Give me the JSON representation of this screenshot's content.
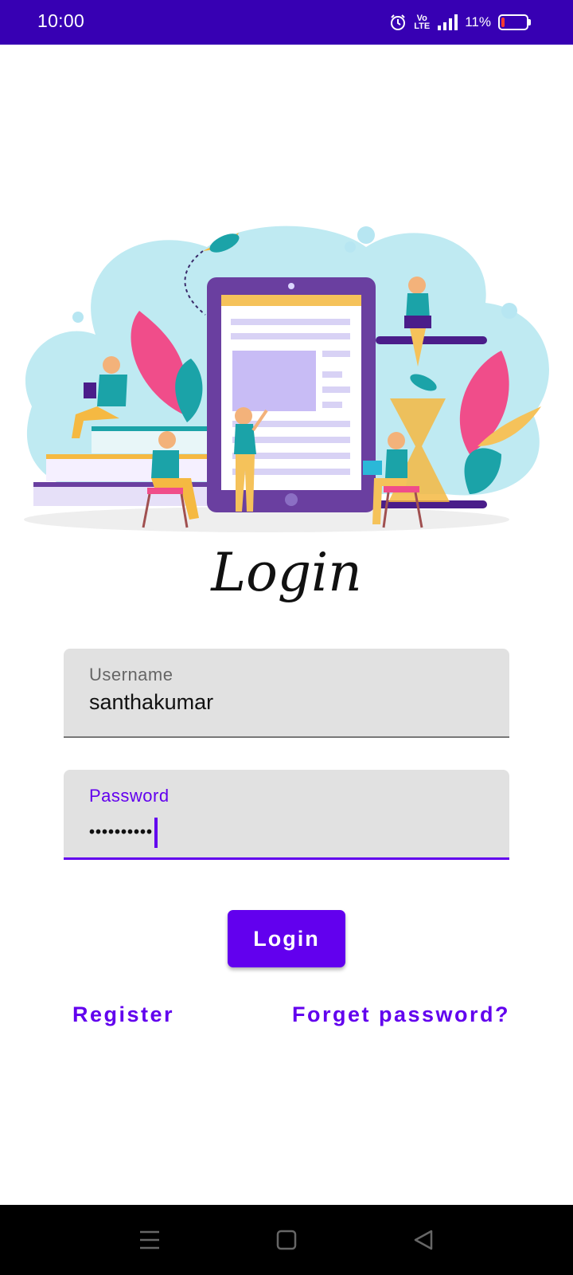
{
  "status_bar": {
    "time": "10:00",
    "volte_top": "Vo",
    "volte_bottom": "LTE",
    "battery_percent": "11%",
    "battery_level": 0.11,
    "icons": [
      "alarm-icon",
      "volte-icon",
      "signal-icon",
      "battery-icon"
    ]
  },
  "title": "Login",
  "form": {
    "username": {
      "label": "Username",
      "value": "santhakumar"
    },
    "password": {
      "label": "Password",
      "value": "••••••••••"
    }
  },
  "buttons": {
    "login": "Login"
  },
  "links": {
    "register": "Register",
    "forgot": "Forget password?"
  },
  "nav_bar": {
    "icons": [
      "menu-icon",
      "home-icon",
      "back-icon"
    ]
  },
  "colors": {
    "status_bar": "#3700b3",
    "accent": "#6200ee",
    "field_bg": "#e1e1e1"
  }
}
